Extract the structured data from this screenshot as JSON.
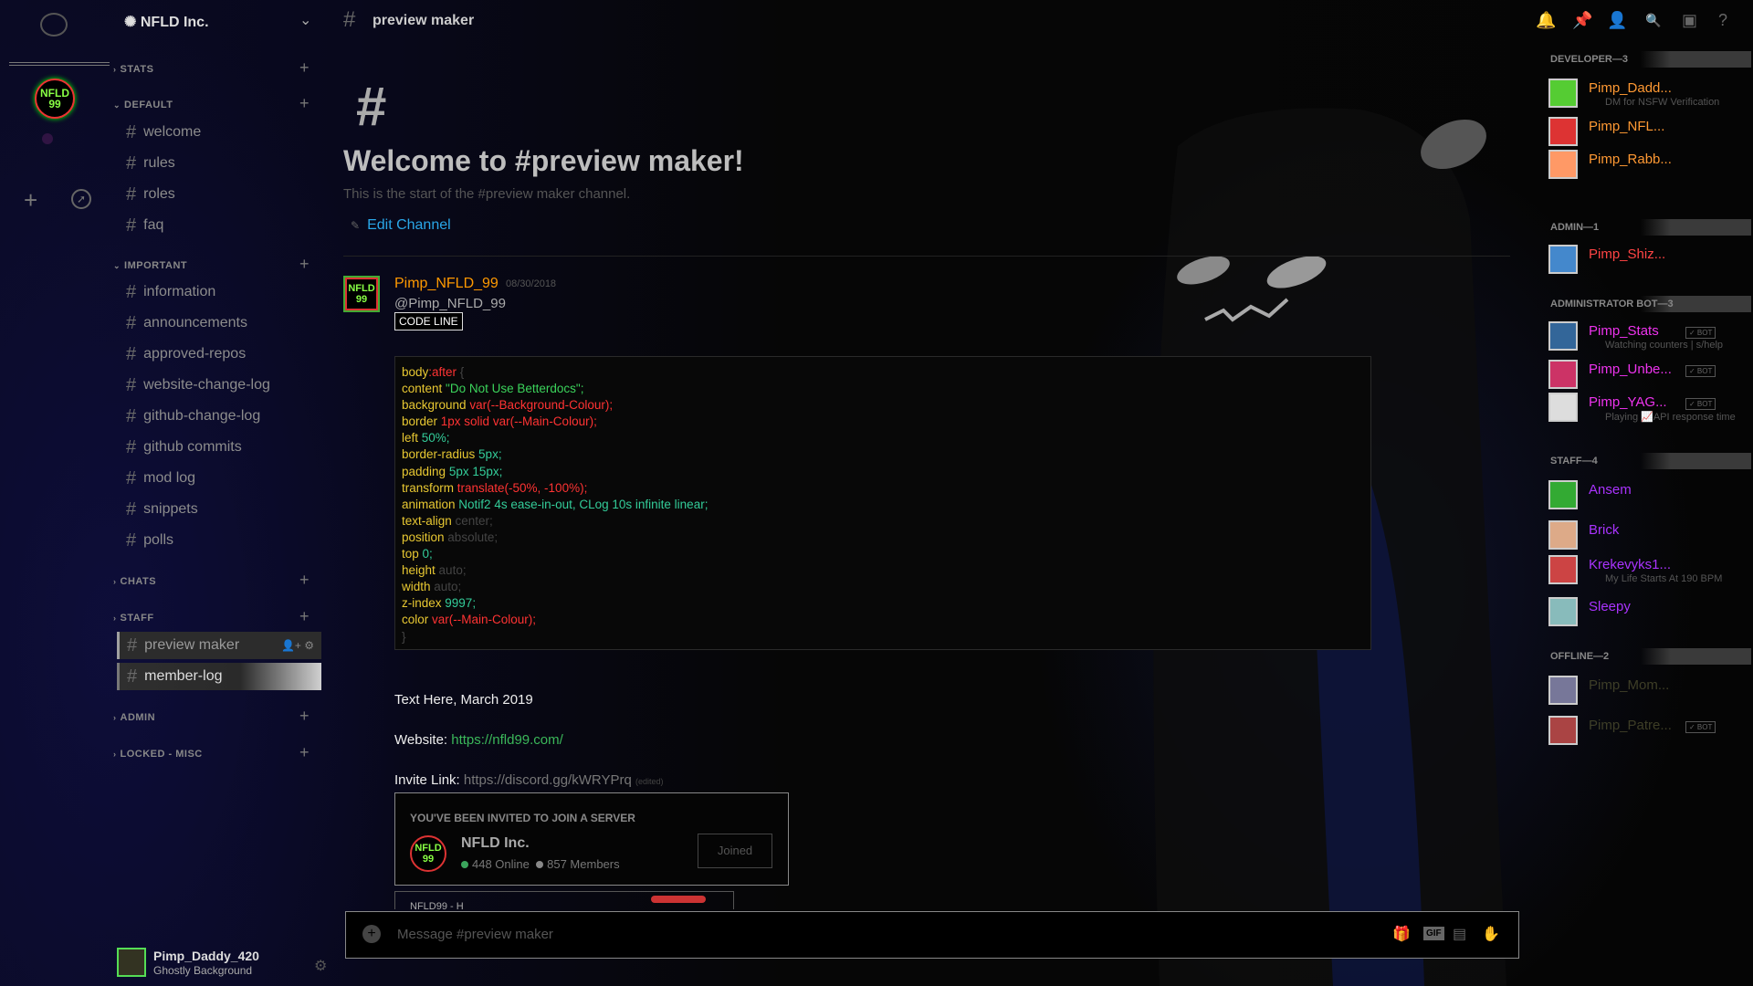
{
  "server": {
    "name": "NFLD Inc.",
    "icon_text": "NFLD 99"
  },
  "rail": {
    "dm_icon": "chat-bubble-icon",
    "add_icon": "plus-icon",
    "explore_icon": "compass-icon"
  },
  "sidebar": {
    "categories": [
      {
        "name": "STATS"
      },
      {
        "name": "DEFAULT"
      },
      {
        "name": "IMPORTANT"
      },
      {
        "name": "CHATS"
      },
      {
        "name": "STAFF"
      },
      {
        "name": "ADMIN"
      },
      {
        "name": "LOCKED - MISC"
      }
    ],
    "default_channels": [
      "welcome",
      "rules",
      "roles",
      "faq"
    ],
    "important_channels": [
      "information",
      "announcements",
      "approved-repos",
      "website-change-log",
      "github-change-log",
      "github commits",
      "mod log",
      "snippets",
      "polls"
    ],
    "staff_channels": [
      "preview maker",
      "member-log"
    ]
  },
  "user": {
    "name": "Pimp_Daddy_420",
    "status": "Ghostly Background"
  },
  "header": {
    "channel": "preview maker"
  },
  "welcome": {
    "title": "Welcome to #preview maker!",
    "subtitle": "This is the start of the #preview maker channel.",
    "edit": "Edit Channel"
  },
  "message": {
    "author": "Pimp_NFLD_99",
    "timestamp": "08/30/2018",
    "mention": "@Pimp_NFLD_99",
    "code_label": "CODE LINE",
    "text_date": "Text Here, March 2019",
    "website_label": "Website: ",
    "website_url": "https://nfld99.com/",
    "invite_label": "Invite Link: ",
    "invite_url": "https://discord.gg/kWRYPrq",
    "edited": "(edited)"
  },
  "code_lines": [
    [
      "body",
      ":after",
      " {"
    ],
    [
      "content",
      " \"Do Not Use Betterdocs\";"
    ],
    [
      "background",
      " var(--Background-Colour);"
    ],
    [
      "border",
      " 1px solid var(--Main-Colour);"
    ],
    [
      "left",
      " 50%;"
    ],
    [
      "border-radius",
      " 5px;"
    ],
    [
      "padding",
      " 5px 15px;"
    ],
    [
      "transform",
      " translate(-50%, -100%);"
    ],
    [
      "animation",
      " Notif2 4s ease-in-out, CLog 10s infinite linear;"
    ],
    [
      "text-align",
      " center;"
    ],
    [
      "position",
      " absolute;"
    ],
    [
      "top",
      " 0;"
    ],
    [
      "height",
      " auto;"
    ],
    [
      "width",
      " auto;"
    ],
    [
      "z-index",
      " 9997;"
    ],
    [
      "color",
      " var(--Main-Colour);"
    ],
    [
      "}",
      ""
    ]
  ],
  "invite": {
    "header": "YOU'VE BEEN INVITED TO JOIN A SERVER",
    "server_name": "NFLD Inc.",
    "online": "448 Online",
    "members": "857 Members",
    "button": "Joined",
    "online_color": "#3ba55c",
    "members_color": "#888888"
  },
  "peek_text": "NFLD99 - H",
  "input": {
    "placeholder": "Message #preview maker"
  },
  "member_list": {
    "roles": [
      {
        "title": "DEVELOPER—3"
      },
      {
        "title": "ADMIN—1"
      },
      {
        "title": "ADMINISTRATOR BOT—3"
      },
      {
        "title": "STAFF—4"
      },
      {
        "title": "OFFLINE—2"
      }
    ],
    "members": [
      {
        "name": "Pimp_Dadd...",
        "sub": "DM for NSFW Verification",
        "color": "orange"
      },
      {
        "name": "Pimp_NFL...",
        "sub": "",
        "color": "orange"
      },
      {
        "name": "Pimp_Rabb...",
        "sub": "",
        "color": "orange"
      },
      {
        "name": "Pimp_Shiz...",
        "sub": "",
        "color": "red"
      },
      {
        "name": "Pimp_Stats",
        "sub": "Watching counters | s/help",
        "color": "magenta",
        "bot": "✓ BOT"
      },
      {
        "name": "Pimp_Unbe...",
        "sub": "",
        "color": "magenta",
        "bot": "✓ BOT"
      },
      {
        "name": "Pimp_YAG...",
        "sub": "Playing 📈API response time",
        "color": "magenta",
        "bot": "✓ BOT"
      },
      {
        "name": "Ansem",
        "sub": "",
        "color": "purple"
      },
      {
        "name": "Brick",
        "sub": "",
        "color": "purple"
      },
      {
        "name": "Krekevyks1...",
        "sub": "My Life Starts At 190 BPM",
        "color": "purple"
      },
      {
        "name": "Sleepy",
        "sub": "",
        "color": "purple"
      },
      {
        "name": "Pimp_Mom...",
        "sub": "",
        "color": "offline"
      },
      {
        "name": "Pimp_Patre...",
        "sub": "",
        "color": "offline",
        "bot": "✓ BOT"
      }
    ]
  }
}
